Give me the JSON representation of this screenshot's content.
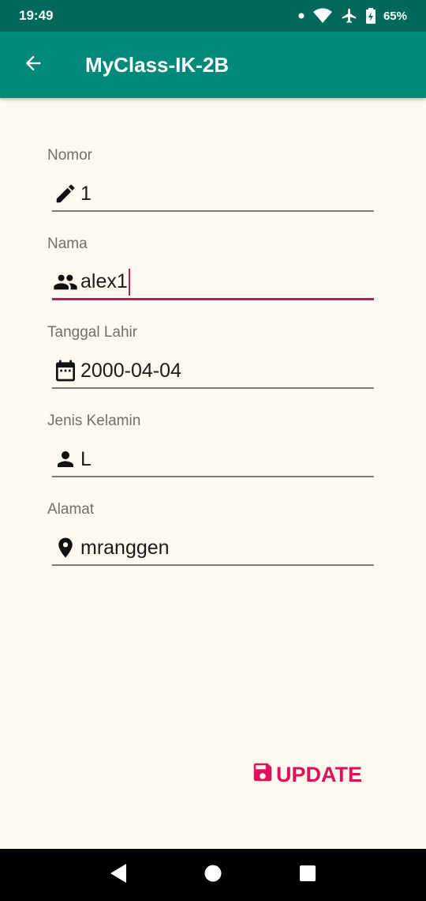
{
  "status_bar": {
    "time": "19:49",
    "battery": "65%",
    "icons": [
      "notification-dot-icon",
      "wifi-icon",
      "airplane-icon",
      "battery-icon"
    ]
  },
  "app_bar": {
    "title": "MyClass-IK-2B",
    "back_icon": "arrow-back-icon",
    "color": "#00897b"
  },
  "form": {
    "fields": [
      {
        "label": "Nomor",
        "value": "1",
        "icon": "pencil-icon"
      },
      {
        "label": "Nama",
        "value": "alex1",
        "icon": "people-icon"
      },
      {
        "label": "Tanggal Lahir",
        "value": "2000-04-04",
        "icon": "calendar-icon"
      },
      {
        "label": "Jenis Kelamin",
        "value": "L",
        "icon": "person-icon"
      },
      {
        "label": "Alamat",
        "value": "mranggen",
        "icon": "location-pin-icon"
      }
    ],
    "focused_index": 1
  },
  "update_button": {
    "label": "UPDATE",
    "icon": "save-icon",
    "color": "#e0105a"
  },
  "nav_bar": {
    "buttons": [
      "back-triangle-icon",
      "home-circle-icon",
      "recents-square-icon"
    ]
  }
}
